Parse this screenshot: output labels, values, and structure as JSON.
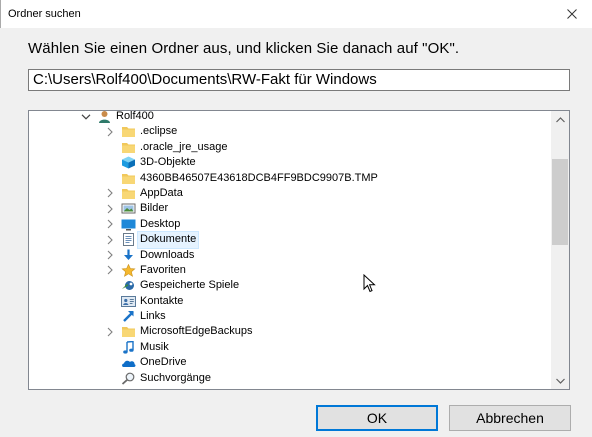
{
  "window": {
    "title": "Ordner suchen"
  },
  "prompt": "Wählen Sie einen Ordner aus, und klicken Sie danach auf \"OK\".",
  "path_value": "C:\\Users\\Rolf400\\Documents\\RW-Fakt für Windows",
  "tree": {
    "items": [
      {
        "label": "Rolf400",
        "icon": "user-icon",
        "chevron": "expanded",
        "depth": 0,
        "selected": false
      },
      {
        "label": ".eclipse",
        "icon": "folder-icon",
        "chevron": "collapsed",
        "depth": 1,
        "selected": false
      },
      {
        "label": ".oracle_jre_usage",
        "icon": "folder-icon",
        "chevron": "none",
        "depth": 1,
        "selected": false
      },
      {
        "label": "3D-Objekte",
        "icon": "3d-objects-icon",
        "chevron": "none",
        "depth": 1,
        "selected": false
      },
      {
        "label": "4360BB46507E43618DCB4FF9BDC9907B.TMP",
        "icon": "folder-icon",
        "chevron": "none",
        "depth": 1,
        "selected": false
      },
      {
        "label": "AppData",
        "icon": "folder-icon",
        "chevron": "collapsed",
        "depth": 1,
        "selected": false
      },
      {
        "label": "Bilder",
        "icon": "pictures-icon",
        "chevron": "collapsed",
        "depth": 1,
        "selected": false
      },
      {
        "label": "Desktop",
        "icon": "desktop-icon",
        "chevron": "collapsed",
        "depth": 1,
        "selected": false
      },
      {
        "label": "Dokumente",
        "icon": "documents-icon",
        "chevron": "collapsed",
        "depth": 1,
        "selected": true
      },
      {
        "label": "Downloads",
        "icon": "downloads-icon",
        "chevron": "collapsed",
        "depth": 1,
        "selected": false
      },
      {
        "label": "Favoriten",
        "icon": "favorites-icon",
        "chevron": "collapsed",
        "depth": 1,
        "selected": false
      },
      {
        "label": "Gespeicherte Spiele",
        "icon": "saved-games-icon",
        "chevron": "none",
        "depth": 1,
        "selected": false
      },
      {
        "label": "Kontakte",
        "icon": "contacts-icon",
        "chevron": "none",
        "depth": 1,
        "selected": false
      },
      {
        "label": "Links",
        "icon": "links-icon",
        "chevron": "none",
        "depth": 1,
        "selected": false
      },
      {
        "label": "MicrosoftEdgeBackups",
        "icon": "folder-icon",
        "chevron": "collapsed",
        "depth": 1,
        "selected": false
      },
      {
        "label": "Musik",
        "icon": "music-icon",
        "chevron": "none",
        "depth": 1,
        "selected": false
      },
      {
        "label": "OneDrive",
        "icon": "onedrive-icon",
        "chevron": "none",
        "depth": 1,
        "selected": false
      },
      {
        "label": "Suchvorgänge",
        "icon": "searches-icon",
        "chevron": "none",
        "depth": 1,
        "selected": false
      },
      {
        "label": "",
        "icon": "folder-icon",
        "chevron": "collapsed",
        "depth": 1,
        "selected": false
      }
    ]
  },
  "buttons": {
    "ok": "OK",
    "cancel": "Abbrechen"
  },
  "colors": {
    "accent": "#0078d7",
    "folder": "#f1c85b",
    "selection": "#e5f3ff",
    "dialog_bg": "#f0f0f0"
  }
}
